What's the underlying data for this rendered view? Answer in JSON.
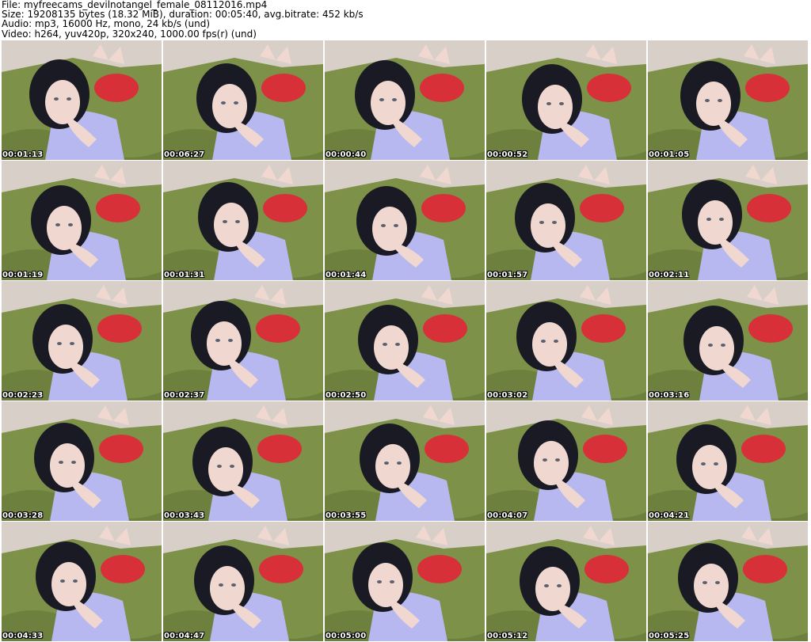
{
  "header": {
    "file_line": "File: myfreecams_devilnotangel_female_08112016.mp4",
    "size_line": "Size: 19208135 bytes (18.32 MiB), duration: 00:05:40, avg.bitrate: 452 kb/s",
    "audio_line": "Audio: mp3, 16000 Hz, mono, 24 kb/s (und)",
    "video_line": "Video: h264, yuv420p, 320x240, 1000.00 fps(r) (und)"
  },
  "thumbnails": [
    {
      "timestamp": "00:01:13"
    },
    {
      "timestamp": "00:06:27"
    },
    {
      "timestamp": "00:00:40"
    },
    {
      "timestamp": "00:00:52"
    },
    {
      "timestamp": "00:01:05"
    },
    {
      "timestamp": "00:01:19"
    },
    {
      "timestamp": "00:01:31"
    },
    {
      "timestamp": "00:01:44"
    },
    {
      "timestamp": "00:01:57"
    },
    {
      "timestamp": "00:02:11"
    },
    {
      "timestamp": "00:02:23"
    },
    {
      "timestamp": "00:02:37"
    },
    {
      "timestamp": "00:02:50"
    },
    {
      "timestamp": "00:03:02"
    },
    {
      "timestamp": "00:03:16"
    },
    {
      "timestamp": "00:03:28"
    },
    {
      "timestamp": "00:03:43"
    },
    {
      "timestamp": "00:03:55"
    },
    {
      "timestamp": "00:04:07"
    },
    {
      "timestamp": "00:04:21"
    },
    {
      "timestamp": "00:04:33"
    },
    {
      "timestamp": "00:04:47"
    },
    {
      "timestamp": "00:05:00"
    },
    {
      "timestamp": "00:05:12"
    },
    {
      "timestamp": "00:05:25"
    }
  ],
  "colors": {
    "wall": "#d8d0c8",
    "bedding": "#7d9148",
    "bedding_dark": "#5f7034",
    "hair": "#1a1a24",
    "skin": "#f0d8d0",
    "shirt": "#b8b8f0",
    "shorts": "#d83038"
  }
}
